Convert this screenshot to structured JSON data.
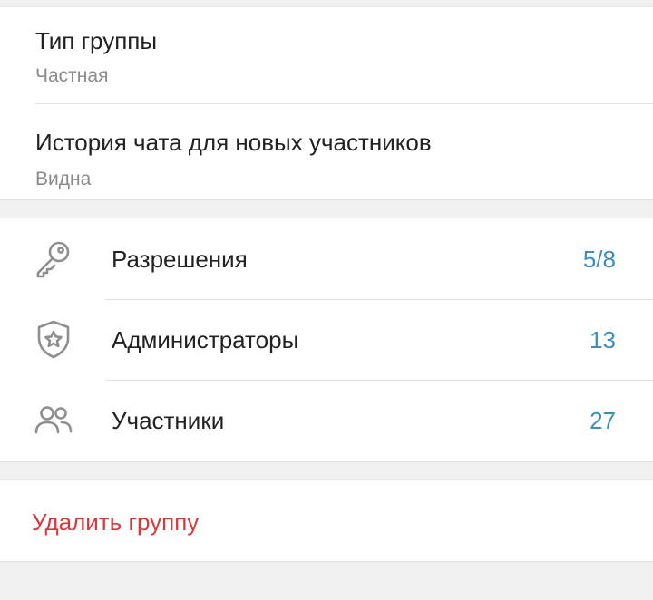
{
  "colors": {
    "accent": "#3a8ec2",
    "danger": "#d9383a",
    "icon": "#8e8e8e"
  },
  "group_settings": {
    "type": {
      "title": "Тип группы",
      "value": "Частная"
    },
    "history": {
      "title": "История чата для новых участников",
      "value": "Видна"
    }
  },
  "management": {
    "permissions": {
      "label": "Разрешения",
      "count": "5/8",
      "icon": "key-icon"
    },
    "admins": {
      "label": "Администраторы",
      "count": "13",
      "icon": "shield-star-icon"
    },
    "members": {
      "label": "Участники",
      "count": "27",
      "icon": "users-icon"
    }
  },
  "danger_zone": {
    "delete_label": "Удалить группу"
  }
}
